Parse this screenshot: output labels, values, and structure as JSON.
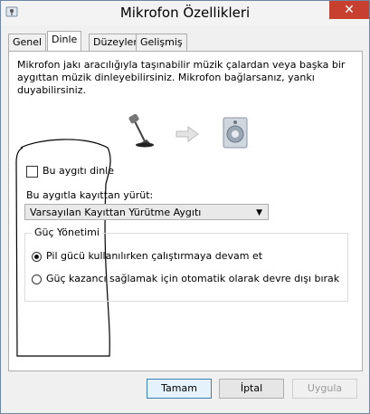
{
  "window": {
    "title": "Mikrofon Özellikleri",
    "close_glyph": "✕"
  },
  "tabs": [
    {
      "label": "Genel",
      "active": false
    },
    {
      "label": "Dinle",
      "active": true
    },
    {
      "label": "Düzeyler",
      "active": false
    },
    {
      "label": "Gelişmiş",
      "active": false
    }
  ],
  "description": "Mikrofon jakı aracılığıyla taşınabilir müzik çalardan veya başka bir aygıttan müzik dinleyebilirsiniz. Mikrofon bağlarsanız, yankı duyabilirsiniz.",
  "illustration": {
    "left_icon": "microphone-icon",
    "arrow_icon": "arrow-right-icon",
    "right_icon": "speaker-icon"
  },
  "listen": {
    "checkbox_label": "Bu aygıtı dinle",
    "checked": false
  },
  "playback": {
    "label": "Bu aygıtla kayıttan yürüt:",
    "selected": "Varsayılan Kayıttan Yürütme Aygıtı"
  },
  "power": {
    "legend": "Güç Yönetimi",
    "options": [
      {
        "label": "Pil gücü kullanılırken çalıştırmaya devam et",
        "selected": true
      },
      {
        "label": "Güç kazancı sağlamak için otomatik olarak devre dışı bırak",
        "selected": false
      }
    ]
  },
  "buttons": {
    "ok": "Tamam",
    "cancel": "İptal",
    "apply": "Uygula"
  },
  "colors": {
    "close": "#c7402f",
    "accent": "#3c7fb1"
  }
}
